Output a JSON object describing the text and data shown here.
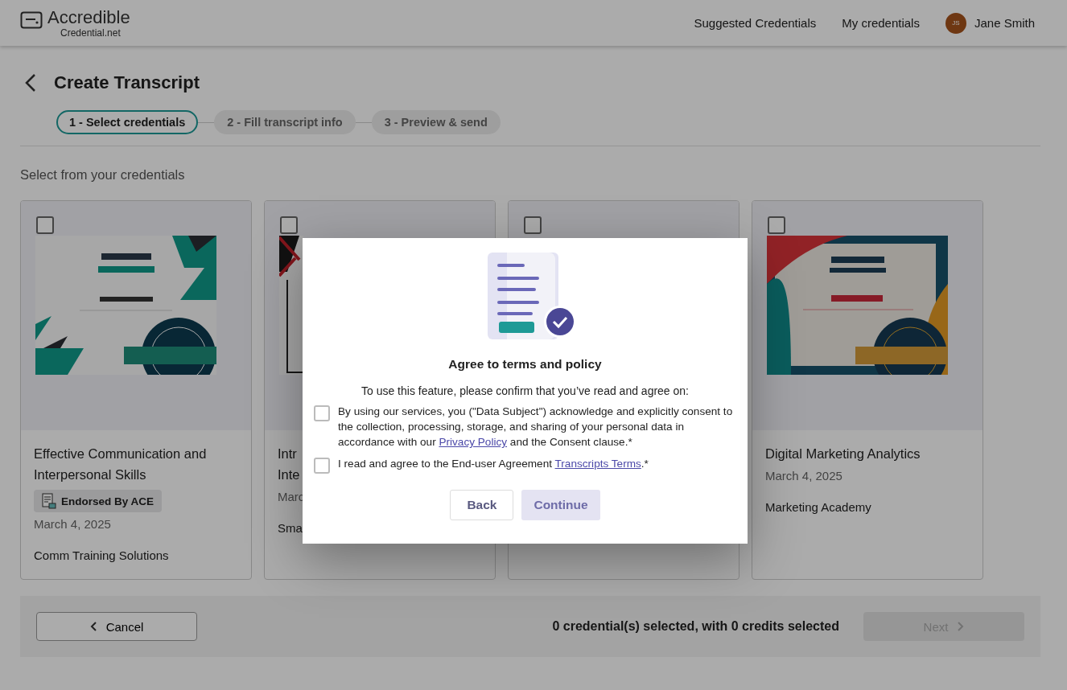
{
  "header": {
    "logo_name": "Accredible",
    "logo_sub": "Credential.net",
    "nav": [
      {
        "label": "Suggested Credentials"
      },
      {
        "label": "My credentials"
      }
    ],
    "user": {
      "initials": "JS",
      "name": "Jane Smith"
    }
  },
  "page": {
    "title": "Create Transcript"
  },
  "steps": [
    {
      "label": "1 - Select credentials",
      "selected": true
    },
    {
      "label": "2 - Fill transcript info",
      "selected": false
    },
    {
      "label": "3 - Preview & send",
      "selected": false
    }
  ],
  "section_title": "Select from your credentials",
  "cards": [
    {
      "checked": false,
      "kind": "achievement",
      "title": "Effective Communication and Interpersonal Skills",
      "badge": "Endorsed By ACE",
      "date": "March 4, 2025",
      "issuer": "Comm Training Solutions"
    },
    {
      "checked": false,
      "kind": "stripes",
      "title": "Intr\nInte",
      "date": "Marc",
      "issuer": "Sma"
    },
    {
      "checked": false,
      "kind": "blank"
    },
    {
      "checked": false,
      "kind": "appreciation",
      "title": "Digital Marketing Analytics",
      "date": "March 4, 2025",
      "issuer": "Marketing Academy"
    }
  ],
  "footer": {
    "cancel": "Cancel",
    "summary": "0 credential(s) selected, with 0 credits selected",
    "next": {
      "label": "Next",
      "disabled": true
    }
  },
  "modal": {
    "title": "Agree to terms and policy",
    "intro": "To use this feature, please confirm that you’ve read and agree on:",
    "items": [
      {
        "checked": false,
        "before": "By using our services, you (\"Data Subject\") acknowledge and explicitly consent to the collection, processing, storage, and sharing of your personal data in accordance with our ",
        "link": "Privacy Policy",
        "after": " and the Consent clause.*"
      },
      {
        "checked": false,
        "before": "I read and agree to the End-user Agreement ",
        "link": "Transcripts Terms",
        "after": ".*"
      }
    ],
    "back": "Back",
    "continue": {
      "label": "Continue",
      "disabled": true
    }
  }
}
